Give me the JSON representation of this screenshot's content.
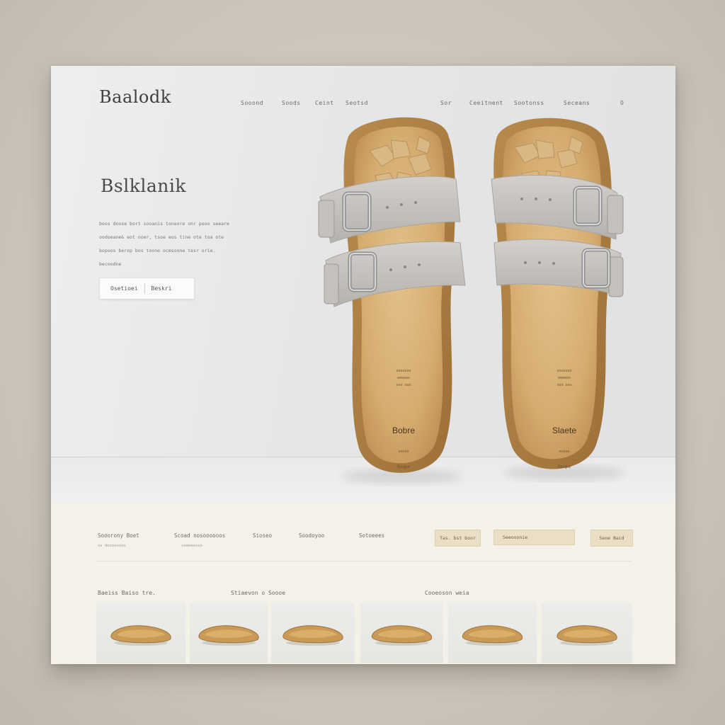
{
  "brand": {
    "logo": "Baalodk"
  },
  "nav": {
    "items": [
      "Sooond",
      "Soods",
      "Ceint",
      "Seotsd",
      "Sor",
      "Ceeitnent",
      "Sootonss",
      "Seceans",
      "O"
    ]
  },
  "hero": {
    "title": "Bslklanik",
    "body_lines": [
      "boos doose bort sooanis toneore onr pooo seeare",
      "oodoeane& eot ooer, tsoe eos tine ote toa ote",
      "bopoos berop bos toone ocmsoone tesr orie.",
      "becoodne"
    ],
    "cta_primary": "Osetioei",
    "cta_secondary": "Beskri"
  },
  "product": {
    "left_insole_brand": "Bobre",
    "right_insole_brand": "Slaete",
    "insole_fine_print": [
      "ooooooo",
      "eeeeoo",
      "ooo ooo",
      "ooooo",
      "Boope"
    ]
  },
  "filters": {
    "labels": [
      "Sooorony Boet",
      "Scoad nosoooooos",
      "Sioseo",
      "Soodoyoo",
      "Sotoeees"
    ],
    "sublabels": [
      "ss doooooooo",
      "soeeeeoso"
    ],
    "buttons": [
      "Tas. bst boor",
      "Seeooonie",
      "Seoe Baid"
    ]
  },
  "categories": {
    "labels": [
      "Baeiss   Baiso tre.",
      "Stiaevon o Soooe",
      "Cooeoson weia"
    ],
    "tiles_count": 6
  },
  "colors": {
    "accent": "#eadfc6",
    "cork": "#c99a55",
    "strap": "#c9c6c2"
  }
}
